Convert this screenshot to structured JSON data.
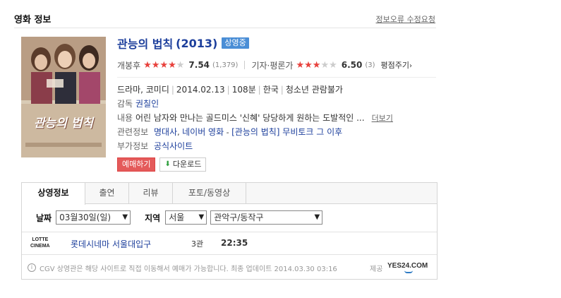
{
  "header": {
    "section_title": "영화 정보",
    "report_link": "정보오류 수정요청"
  },
  "movie": {
    "title": "관능의 법칙",
    "year": "(2013)",
    "status": "상영중",
    "poster_text": "관능의 법칙"
  },
  "ratings": {
    "audience_label": "개봉후",
    "audience_score": "7.54",
    "audience_count": "(1,379)",
    "audience_stars": 4,
    "critic_label": "기자·평론가",
    "critic_score": "6.50",
    "critic_count": "(3)",
    "critic_stars": 3,
    "rate_link": "평점주기",
    "star_color": "#e8413c"
  },
  "meta": {
    "genre": "드라마, 코미디",
    "release_date": "2014.02.13",
    "runtime": "108분",
    "country": "한국",
    "rating": "청소년 관람불가",
    "director_key": "감독",
    "director": "권칠인",
    "plot_key": "내용",
    "plot": "어린 남자와 만나는 골드미스 '신혜' 당당하게 원하는 도발적인 ...",
    "plot_more": "더보기",
    "related_key": "관련정보",
    "related_link_1": "명대사",
    "related_link_2": "네이버 영화",
    "related_link_3": "[관능의 법칙] 무비토크 그 이후",
    "extra_key": "부가정보",
    "extra_link": "공식사이트"
  },
  "buttons": {
    "reserve": "예매하기",
    "download": "다운로드"
  },
  "tabs": [
    {
      "label": "상영정보",
      "active": true
    },
    {
      "label": "출연",
      "active": false
    },
    {
      "label": "리뷰",
      "active": false
    },
    {
      "label": "포토/동영상",
      "active": false
    }
  ],
  "filters": {
    "date_label": "날짜",
    "date_value": "03월30일(일)",
    "region_label": "지역",
    "region_value": "서울",
    "district_value": "관악구/동작구"
  },
  "showtimes": [
    {
      "logo_line1": "LOTTE",
      "logo_line2": "CINEMA",
      "theater": "롯데시네마 서울대입구",
      "hall": "3관",
      "time": "22:35"
    }
  ],
  "notice": {
    "text": "CGV 상영관은 해당 사이트로 직접 이동해서 예매가 가능합니다. 최종 업데이트 2014.03.30 03:16",
    "provider_label": "제공",
    "provider_logo": "YES24.COM"
  }
}
